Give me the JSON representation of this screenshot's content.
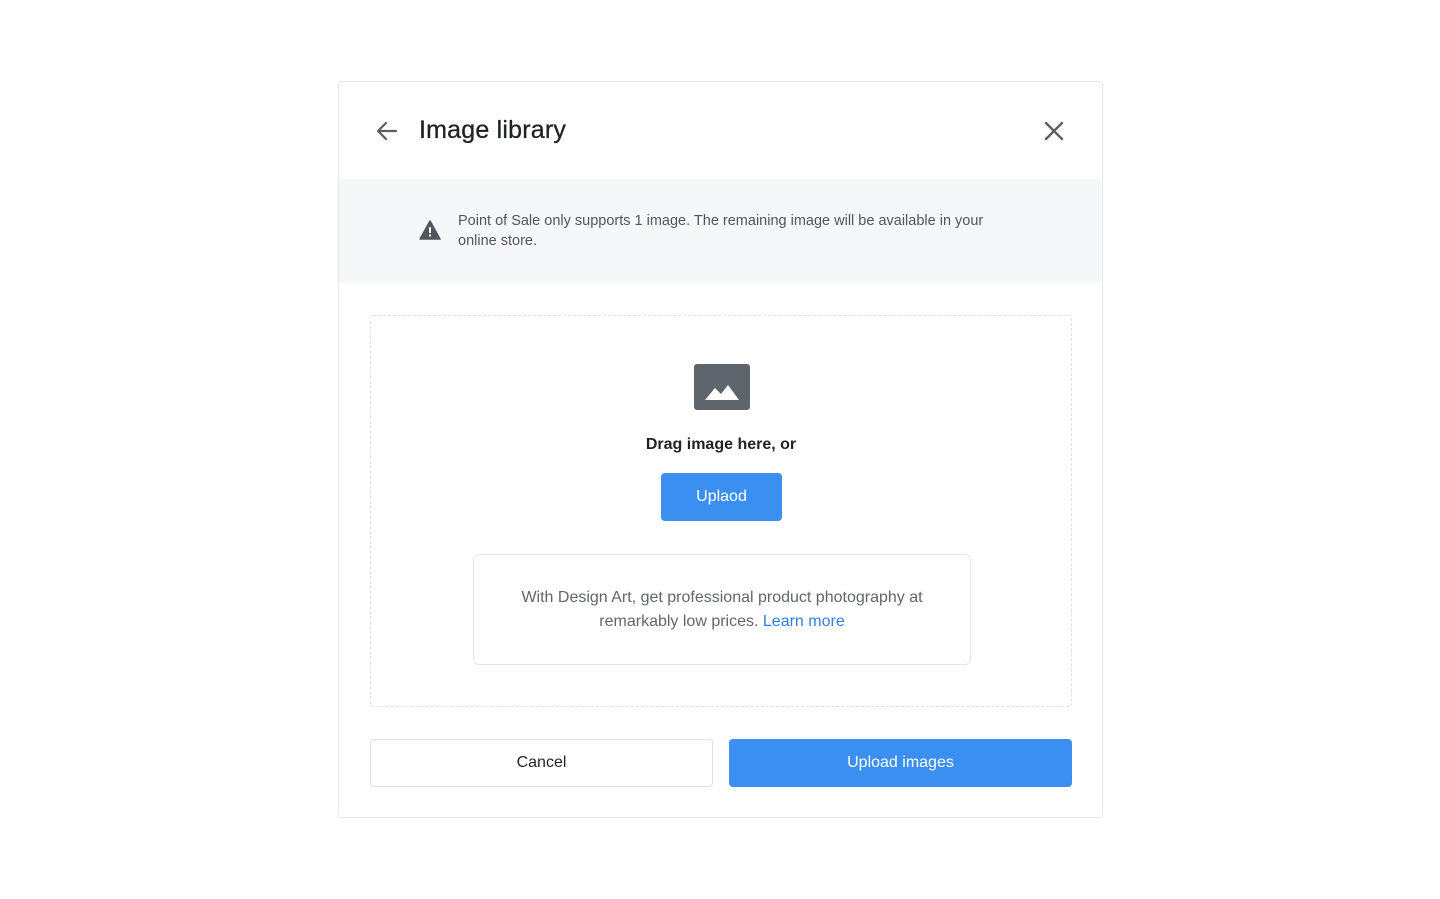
{
  "dialog": {
    "title": "Image library",
    "back_icon": "arrow-left-icon",
    "close_icon": "close-icon"
  },
  "notice": {
    "icon": "warning-icon",
    "text": "Point of Sale only supports 1 image. The remaining image will be available in your online store."
  },
  "dropzone": {
    "icon": "image-placeholder-icon",
    "drag_text": "Drag image here, or",
    "upload_label": "Uplaod",
    "promo_text": "With Design Art, get professional product photography at remarkably low prices.",
    "learn_more_label": "Learn more"
  },
  "footer": {
    "cancel_label": "Cancel",
    "submit_label": "Upload images"
  },
  "colors": {
    "accent": "#3b8ff0",
    "link": "#2f80e4",
    "notice_bg": "#f6f7f8"
  }
}
